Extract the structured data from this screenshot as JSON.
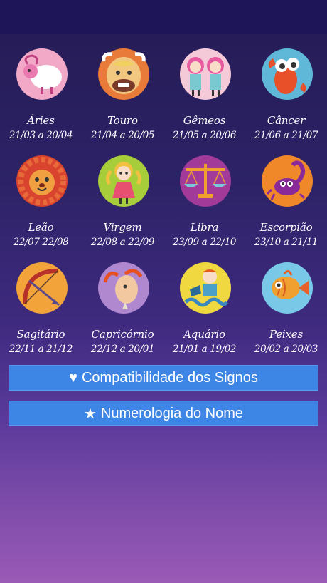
{
  "signs": [
    {
      "name": "Áries",
      "dates": "21/03 a 20/04",
      "icon": "aries-ram-icon",
      "color": "#f2a9c8"
    },
    {
      "name": "Touro",
      "dates": "21/04 a 20/05",
      "icon": "taurus-bull-icon",
      "color": "#e87a3a"
    },
    {
      "name": "Gêmeos",
      "dates": "21/05 a 20/06",
      "icon": "gemini-twins-icon",
      "color": "#f4c9d8"
    },
    {
      "name": "Câncer",
      "dates": "21/06 a 21/07",
      "icon": "cancer-crab-icon",
      "color": "#5fb8d8"
    },
    {
      "name": "Leão",
      "dates": "22/07  22/08",
      "icon": "leo-lion-icon",
      "color": "#d8442e"
    },
    {
      "name": "Virgem",
      "dates": "22/08 a 22/09",
      "icon": "virgo-girl-icon",
      "color": "#a8cd3a"
    },
    {
      "name": "Libra",
      "dates": "23/09 a 22/10",
      "icon": "libra-scales-icon",
      "color": "#a23a9a"
    },
    {
      "name": "Escorpião",
      "dates": "23/10 a 21/11",
      "icon": "scorpio-scorpion-icon",
      "color": "#f0882a"
    },
    {
      "name": "Sagitário",
      "dates": "22/11 a 21/12",
      "icon": "sagittarius-bow-icon",
      "color": "#f2a33a"
    },
    {
      "name": "Capricórnio",
      "dates": "22/12 a 20/01",
      "icon": "capricorn-goat-icon",
      "color": "#b088d0"
    },
    {
      "name": "Aquário",
      "dates": "21/01 a 19/02",
      "icon": "aquarius-water-icon",
      "color": "#f0d840"
    },
    {
      "name": "Peixes",
      "dates": "20/02 a 20/03",
      "icon": "pisces-fish-icon",
      "color": "#7ac8e8"
    }
  ],
  "buttons": {
    "compat_label": "Compatibilidade dos Signos",
    "compat_icon": "heart-icon",
    "numerology_label": "Numerologia do Nome",
    "numerology_icon": "star-icon"
  },
  "colors": {
    "button": "#3d86e6",
    "status_bar": "#1e1458"
  }
}
